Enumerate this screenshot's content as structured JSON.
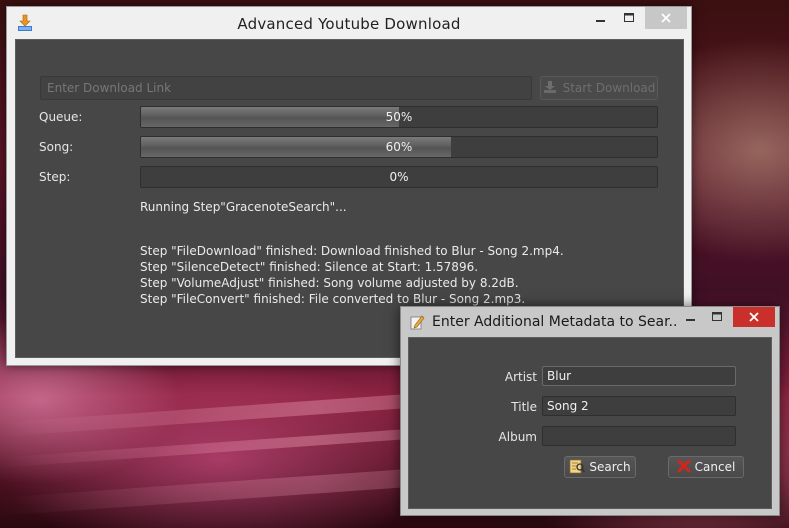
{
  "main_window": {
    "title": "Advanced Youtube Download",
    "url_placeholder": "Enter Download Link",
    "start_button_label": "Start Download",
    "rows": {
      "queue": {
        "label": "Queue:",
        "percent_text": "50%",
        "progress": 0.5
      },
      "song": {
        "label": "Song:",
        "percent_text": "60%",
        "progress": 0.6
      },
      "step": {
        "label": "Step:",
        "percent_text": "0%",
        "progress": 0.0
      }
    },
    "status": "Running Step\"GracenoteSearch\"...",
    "log": [
      "Step \"FileDownload\" finished: Download finished to Blur - Song 2.mp4.",
      "Step \"SilenceDetect\" finished: Silence at Start: 1.57896.",
      "Step \"VolumeAdjust\" finished: Song volume adjusted by 8.2dB.",
      "Step \"FileConvert\" finished: File converted to Blur - Song 2.mp3."
    ]
  },
  "dialog": {
    "title": "Enter Additional Metadata to Sear...",
    "fields": {
      "artist": {
        "label": "Artist",
        "value": "Blur"
      },
      "title": {
        "label": "Title",
        "value": "Song 2"
      },
      "album": {
        "label": "Album",
        "value": ""
      }
    },
    "search_label": "Search",
    "cancel_label": "Cancel"
  },
  "colors": {
    "client_bg": "#474747",
    "progress_fill": "#6a6a6a",
    "close_button_active": "#c9302c"
  },
  "icons": {
    "app": "download-arrow-icon",
    "start": "download-icon",
    "dialog": "pencil-note-icon",
    "search": "search-notes-icon",
    "cancel": "red-x-icon"
  }
}
